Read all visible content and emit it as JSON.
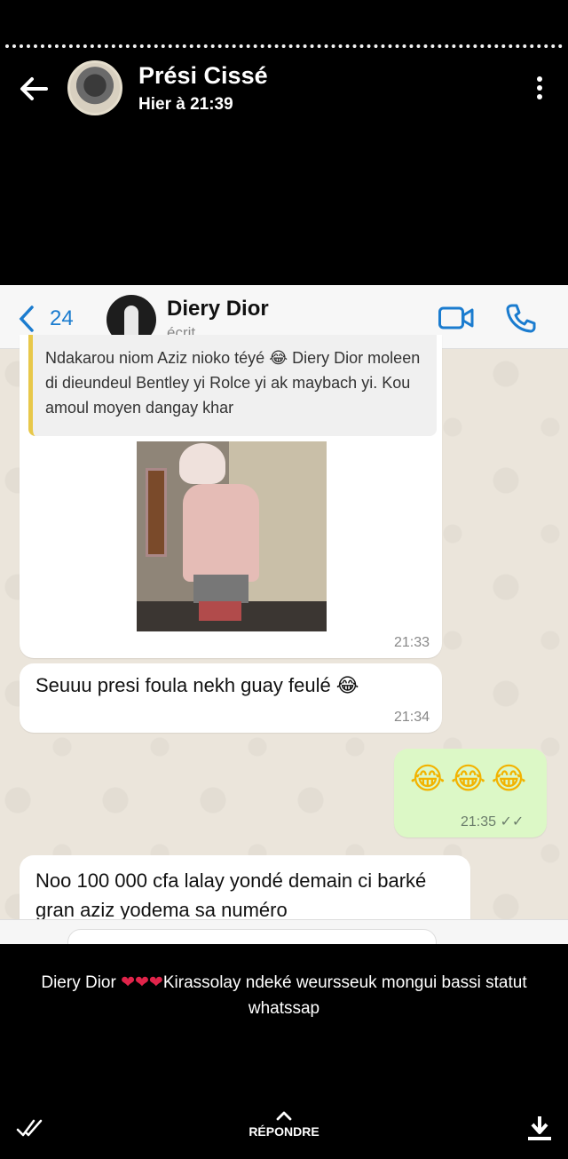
{
  "status": {
    "poster_name": "Prési Cissé",
    "posted_time": "Hier à 21:39",
    "caption_before": "Diery Dior ",
    "caption_hearts": "❤❤❤",
    "caption_after": "Kirassolay ndeké weursseuk mongui bassi statut whatssap",
    "reply_label": "RÉPONDRE"
  },
  "screenshot": {
    "chat_header": {
      "back_count": "24",
      "contact_name": "Diery Dior",
      "contact_status": "écrit..."
    },
    "messages": [
      {
        "direction": "incoming",
        "quoted_text": "Ndakarou niom Aziz nioko téyé 😂 Diery Dior moleen di dieundeul Bentley yi Rolce yi ak maybach yi. Kou amoul moyen dangay khar",
        "has_image": true,
        "time": "21:33"
      },
      {
        "direction": "incoming",
        "text": "Seuuu presi foula nekh guay feulé 😂",
        "time": "21:34"
      },
      {
        "direction": "outgoing",
        "text": "😂😂😂",
        "time": "21:35 ✓✓"
      },
      {
        "direction": "incoming",
        "text": "Noo 100 000 cfa lalay yondé demain ci barké gran aziz yodema sa numéro"
      }
    ]
  },
  "colors": {
    "whatsapp_link": "#1b7ccf",
    "outgoing_bubble": "#dcf8c6",
    "quote_bar": "#e8c84a",
    "heart": "#e0244a"
  },
  "icons": [
    "back-arrow-icon",
    "more-options-icon",
    "chevron-left-icon",
    "video-call-icon",
    "phone-call-icon",
    "double-check-icon",
    "chevron-up-icon",
    "download-icon"
  ]
}
